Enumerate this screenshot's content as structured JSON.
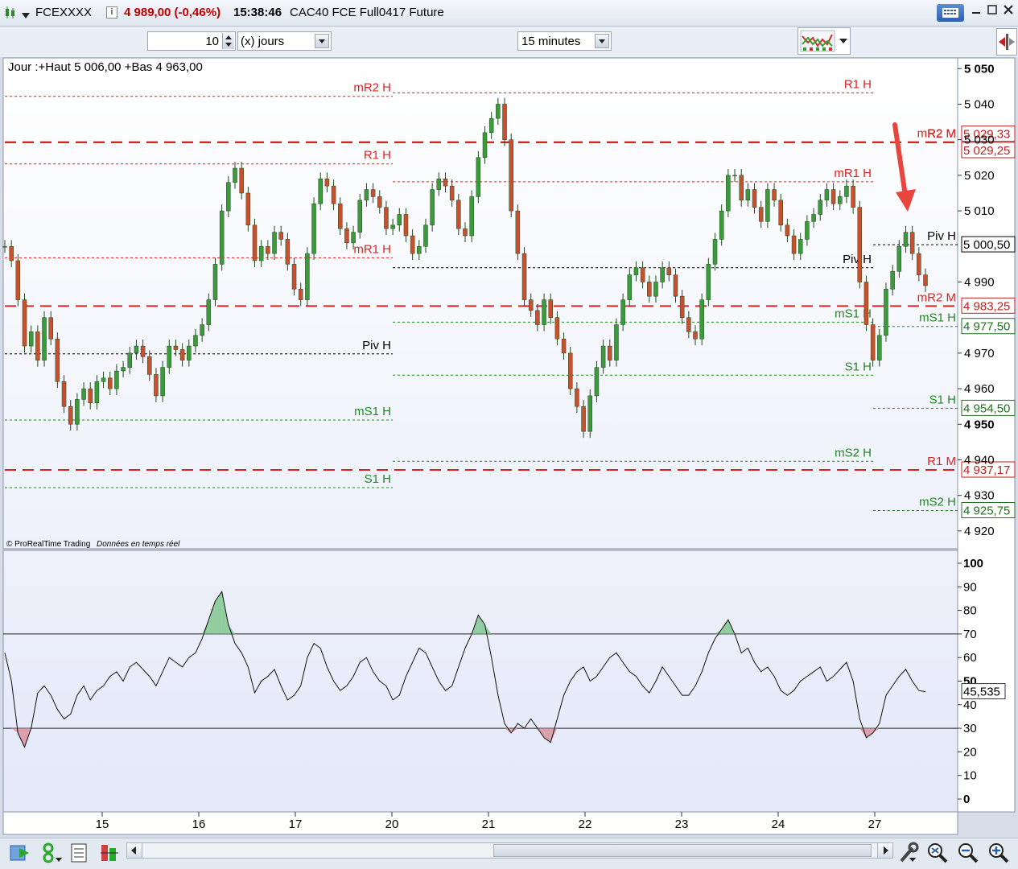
{
  "window": {
    "symbol": "FCEXXXX",
    "price_change": "4 989,00 (-0,46%)",
    "time": "15:38:46",
    "instrument": "CAC40 FCE Full0417 Future"
  },
  "toolbar": {
    "period_value": "10",
    "period_unit": "(x) jours",
    "timeframe": "15 minutes"
  },
  "chart_data": [
    {
      "type": "candlestick",
      "title": "Jour :+Haut 5 006,00 +Bas 4 963,00",
      "footer": "© ProRealTime Trading",
      "footer_note": "Données en temps réel",
      "ylim": [
        4915,
        5053
      ],
      "y_ticks": [
        "5 050",
        "5 040",
        "5 030",
        "5 020",
        "5 010",
        "4 990",
        "4 970",
        "4 960",
        "4 950",
        "4 940",
        "4 930",
        "4 920"
      ],
      "x_labels": [
        "15",
        "16",
        "17",
        "20",
        "21",
        "22",
        "23",
        "24",
        "27"
      ],
      "series": [
        {
          "values": [
            5000,
            4996,
            4985,
            4972,
            4976,
            4968,
            4980,
            4974,
            4962,
            4955,
            4950,
            4957,
            4960,
            4956,
            4962,
            4963,
            4960,
            4965,
            4966,
            4970,
            4972,
            4969,
            4964,
            4958,
            4966,
            4972,
            4971,
            4968,
            4972,
            4975,
            4978,
            4985,
            4995,
            5010,
            5018,
            5022,
            5015,
            5006,
            4996,
            5000,
            4998,
            5004,
            5002,
            4995,
            4988,
            4985,
            4998,
            5012,
            5019,
            5017,
            5012,
            5005,
            5001,
            5004,
            5013,
            5016,
            5014,
            5011,
            5005,
            5006,
            5009,
            5003,
            4998,
            5000,
            5006,
            5016,
            5019,
            5017,
            5013,
            5005,
            5003,
            5014,
            5025,
            5032,
            5036,
            5040,
            5030,
            5010,
            4998,
            4985,
            4982,
            4978,
            4985,
            4980,
            4974,
            4970,
            4960,
            4955,
            4948,
            4958,
            4966,
            4972,
            4968,
            4978,
            4985,
            4992,
            4994,
            4990,
            4986,
            4990,
            4994,
            4992,
            4986,
            4980,
            4976,
            4974,
            4985,
            4995,
            5002,
            5010,
            5020,
            5020,
            5013,
            5016,
            5011,
            5007,
            5016,
            5013,
            5006,
            5003,
            4998,
            5002,
            5007,
            5009,
            5013,
            5016,
            5012,
            5014,
            5017,
            5011,
            4990,
            4978,
            4968,
            4975,
            4988,
            4993,
            5000,
            5004,
            4998,
            4992,
            4989
          ]
        }
      ],
      "pivot_lines": [
        {
          "label": "mR2 H",
          "value": 5042.2,
          "color": "#dd2222",
          "segment": "left"
        },
        {
          "label": "R1 H",
          "value": 5043.2,
          "color": "#dd2222",
          "segment": "mid"
        },
        {
          "label": "mR2 M",
          "value": 5029.33,
          "color": "#dd2222",
          "segment": "full"
        },
        {
          "label": "R2 M",
          "value": 5029.25,
          "color": "#dd2222",
          "segment": "full"
        },
        {
          "label": "R1 H",
          "value": 5023.2,
          "color": "#dd2222",
          "segment": "left"
        },
        {
          "label": "mR1 H",
          "value": 5018.2,
          "color": "#dd2222",
          "segment": "mid"
        },
        {
          "label": "mR1 H",
          "value": 4996.8,
          "color": "#dd2222",
          "segment": "left"
        },
        {
          "label": "Piv H",
          "value": 4994,
          "color": "#000000",
          "segment": "mid"
        },
        {
          "label": "Piv H",
          "value": 5000.5,
          "color": "#000000",
          "segment": "right"
        },
        {
          "label": "mR2 M",
          "value": 4983.25,
          "color": "#dd2222",
          "segment": "full"
        },
        {
          "label": "mS1 H",
          "value": 4978.7,
          "color": "#228822",
          "segment": "mid"
        },
        {
          "label": "mS1 H",
          "value": 4977.5,
          "color": "#228822",
          "segment": "right"
        },
        {
          "label": "Piv H",
          "value": 4969.8,
          "color": "#000000",
          "segment": "left"
        },
        {
          "label": "S1 H",
          "value": 4963.8,
          "color": "#228822",
          "segment": "mid"
        },
        {
          "label": "S1 H",
          "value": 4954.5,
          "color": "#228822",
          "segment": "right"
        },
        {
          "label": "mS1 H",
          "value": 4951.2,
          "color": "#228822",
          "segment": "left"
        },
        {
          "label": "mS2 H",
          "value": 4939.6,
          "color": "#228822",
          "segment": "mid"
        },
        {
          "label": "R1 M",
          "value": 4937.17,
          "color": "#dd2222",
          "segment": "full"
        },
        {
          "label": "S1 H",
          "value": 4932.2,
          "color": "#228822",
          "segment": "left"
        },
        {
          "label": "mS2 H",
          "value": 4925.75,
          "color": "#228822",
          "segment": "right"
        }
      ],
      "price_badges": [
        "5 029,33",
        "5 029,25",
        "5 000,50",
        "4 983,25",
        "4 977,50",
        "4 954,50",
        "4 937,17",
        "4 925,75"
      ]
    },
    {
      "type": "line",
      "ylim": [
        0,
        100
      ],
      "y_ticks": [
        "100",
        "90",
        "80",
        "70",
        "60",
        "50",
        "40",
        "30",
        "20",
        "10",
        "0"
      ],
      "levels": [
        70,
        30
      ],
      "last_value": "45,535",
      "series": [
        {
          "values": [
            62,
            50,
            28,
            22,
            30,
            45,
            48,
            44,
            38,
            34,
            36,
            44,
            48,
            42,
            46,
            48,
            52,
            54,
            50,
            56,
            58,
            55,
            52,
            48,
            54,
            60,
            58,
            56,
            60,
            62,
            68,
            76,
            84,
            88,
            74,
            66,
            62,
            56,
            45,
            50,
            52,
            55,
            48,
            42,
            44,
            48,
            60,
            66,
            64,
            56,
            50,
            46,
            48,
            52,
            58,
            60,
            54,
            50,
            48,
            42,
            44,
            52,
            58,
            64,
            62,
            56,
            50,
            46,
            48,
            56,
            64,
            70,
            78,
            74,
            60,
            44,
            32,
            28,
            32,
            30,
            34,
            30,
            26,
            24,
            34,
            44,
            50,
            54,
            56,
            50,
            52,
            56,
            60,
            62,
            58,
            54,
            52,
            48,
            45,
            50,
            56,
            52,
            48,
            44,
            44,
            48,
            54,
            62,
            68,
            72,
            76,
            70,
            62,
            64,
            58,
            54,
            56,
            52,
            46,
            44,
            46,
            50,
            52,
            54,
            56,
            50,
            52,
            55,
            58,
            50,
            34,
            26,
            28,
            32,
            44,
            48,
            52,
            55,
            50,
            46,
            45.5
          ]
        }
      ]
    }
  ],
  "icons": {
    "calculator": "calculator-icon",
    "minimize": "minimize-icon",
    "maximize": "maximize-icon",
    "close": "close-icon",
    "indicator": "indicator-icon",
    "side_arrows": "arrows-icon"
  }
}
